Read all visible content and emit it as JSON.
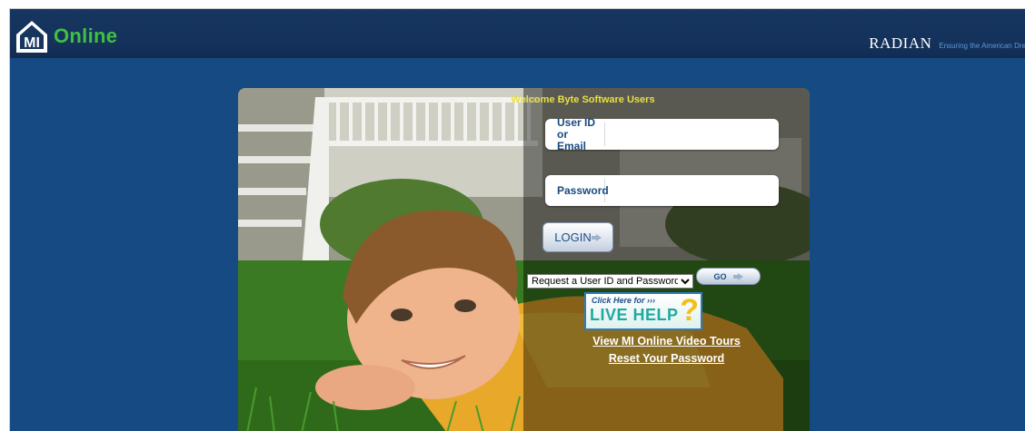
{
  "header": {
    "logo_mark": "MI",
    "logo_text": "Online",
    "partner_name": "RADIAN",
    "partner_tagline": "Ensuring the American Dre"
  },
  "login": {
    "welcome": "Welcome Byte Software Users",
    "userid_label_line1": "User ID or",
    "userid_label_line2": "Email",
    "userid_value": "",
    "password_label": "Password",
    "password_value": "",
    "login_button": "LOGIN"
  },
  "request": {
    "selected": "Request a User ID and Password",
    "go_button": "GO"
  },
  "live_help": {
    "top": "Click Here for ›››",
    "main": "LIVE HELP"
  },
  "links": {
    "video_tours": "View MI Online Video Tours",
    "reset_password": "Reset Your Password"
  },
  "colors": {
    "page_bg": "#154a82",
    "header_bg": "#14325b",
    "logo_green": "#40c040",
    "welcome_yellow": "#e8e040",
    "label_blue": "#1a4a80"
  }
}
